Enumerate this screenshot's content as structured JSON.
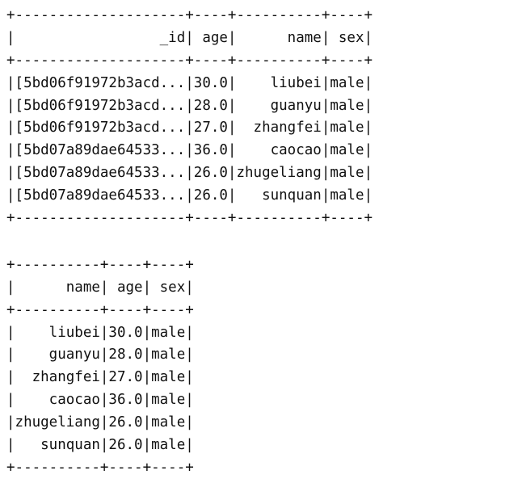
{
  "tables": [
    {
      "lines": [
        "+--------------------+----+----------+----+",
        "|                 _id| age|      name| sex|",
        "+--------------------+----+----------+----+",
        "|[5bd06f91972b3acd...|30.0|    liubei|male|",
        "|[5bd06f91972b3acd...|28.0|    guanyu|male|",
        "|[5bd06f91972b3acd...|27.0|  zhangfei|male|",
        "|[5bd07a89dae64533...|36.0|    caocao|male|",
        "|[5bd07a89dae64533...|26.0|zhugeliang|male|",
        "|[5bd07a89dae64533...|26.0|   sunquan|male|",
        "+--------------------+----+----------+----+"
      ]
    },
    {
      "lines": [
        "+----------+----+----+",
        "|      name| age| sex|",
        "+----------+----+----+",
        "|    liubei|30.0|male|",
        "|    guanyu|28.0|male|",
        "|  zhangfei|27.0|male|",
        "|    caocao|36.0|male|",
        "|zhugeliang|26.0|male|",
        "|   sunquan|26.0|male|",
        "+----------+----+----+"
      ]
    }
  ]
}
